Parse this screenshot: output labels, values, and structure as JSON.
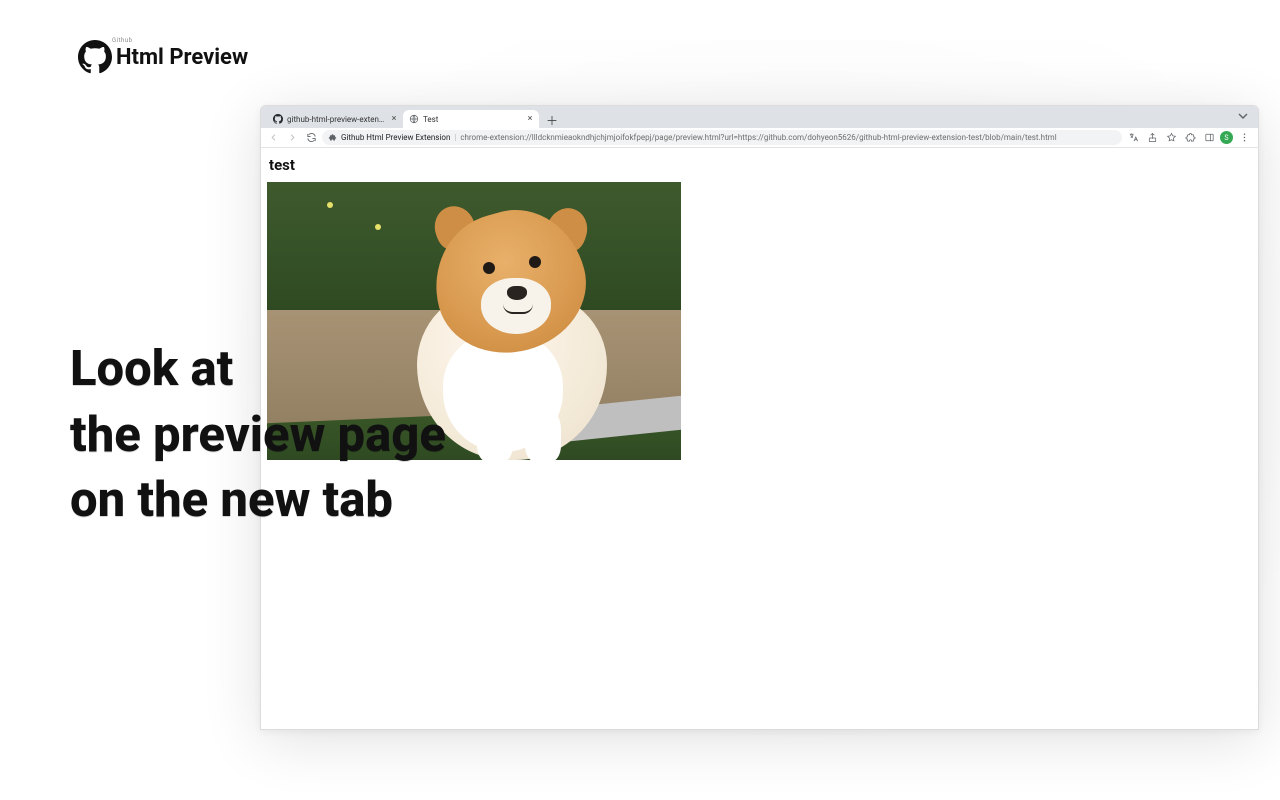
{
  "header": {
    "title": "Html Preview",
    "sublabel": "Github"
  },
  "headline": {
    "line1": "Look at",
    "line2": "the preview page",
    "line3": "on the new tab"
  },
  "browser": {
    "tabs": [
      {
        "label": "github-html-preview-extension",
        "favicon": "github-icon"
      },
      {
        "label": "Test",
        "favicon": "globe-icon"
      }
    ],
    "url": {
      "extension_name": "Github Html Preview Extension",
      "path": "chrome-extension://llldcknmieaokndhjchjmjoifokfpepj/page/preview.html?url=https://github.com/dohyeon5626/github-html-preview-extension-test/blob/main/test.html"
    },
    "toolbar_icons": {
      "translate": "translate-icon",
      "share": "share-icon",
      "star": "star-icon",
      "extensions": "puzzle-icon",
      "sidepanel": "panel-icon",
      "avatar_initial": "S",
      "menu": "menu-icon"
    },
    "page": {
      "heading": "test"
    }
  }
}
